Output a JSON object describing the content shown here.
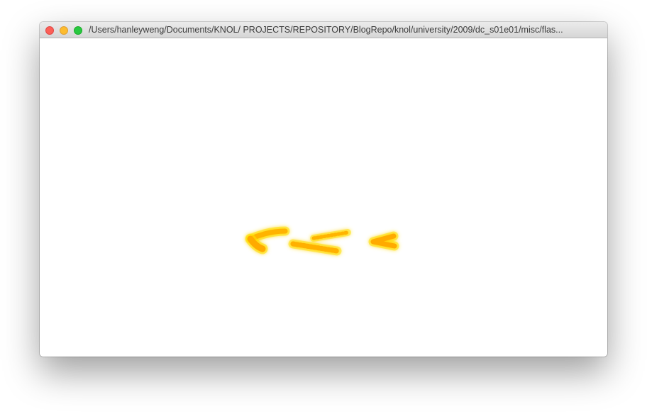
{
  "window": {
    "title": "/Users/hanleyweng/Documents/KNOL/ PROJECTS/REPOSITORY/BlogRepo/knol/university/2009/dc_s01e01/misc/flas..."
  },
  "traffic_lights": {
    "close_color": "#fc5f57",
    "minimize_color": "#fdbc2e",
    "zoom_color": "#28c840"
  },
  "content": {
    "background": "#ffffff",
    "stroke_core_color": "#ffb000",
    "stroke_glow_color": "#ffe100",
    "icon": "glowing-brush-strokes"
  }
}
